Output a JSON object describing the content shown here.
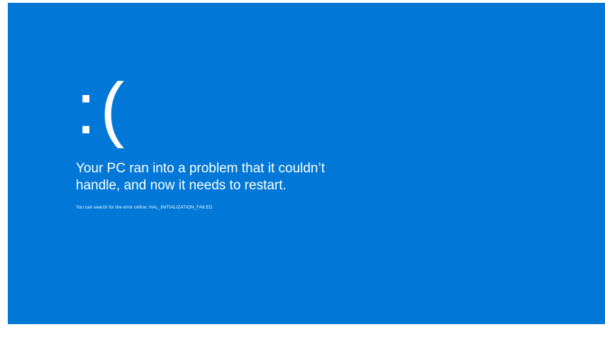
{
  "bsod": {
    "emoticon": ":(",
    "message_line1": "Your PC ran into a problem that it couldn’t",
    "message_line2": "handle, and now it needs to restart.",
    "error_text": "You can search for the error online: HAL_INITIALIZATION_FAILED"
  },
  "colors": {
    "background": "#0178d7",
    "text": "#ffffff"
  }
}
